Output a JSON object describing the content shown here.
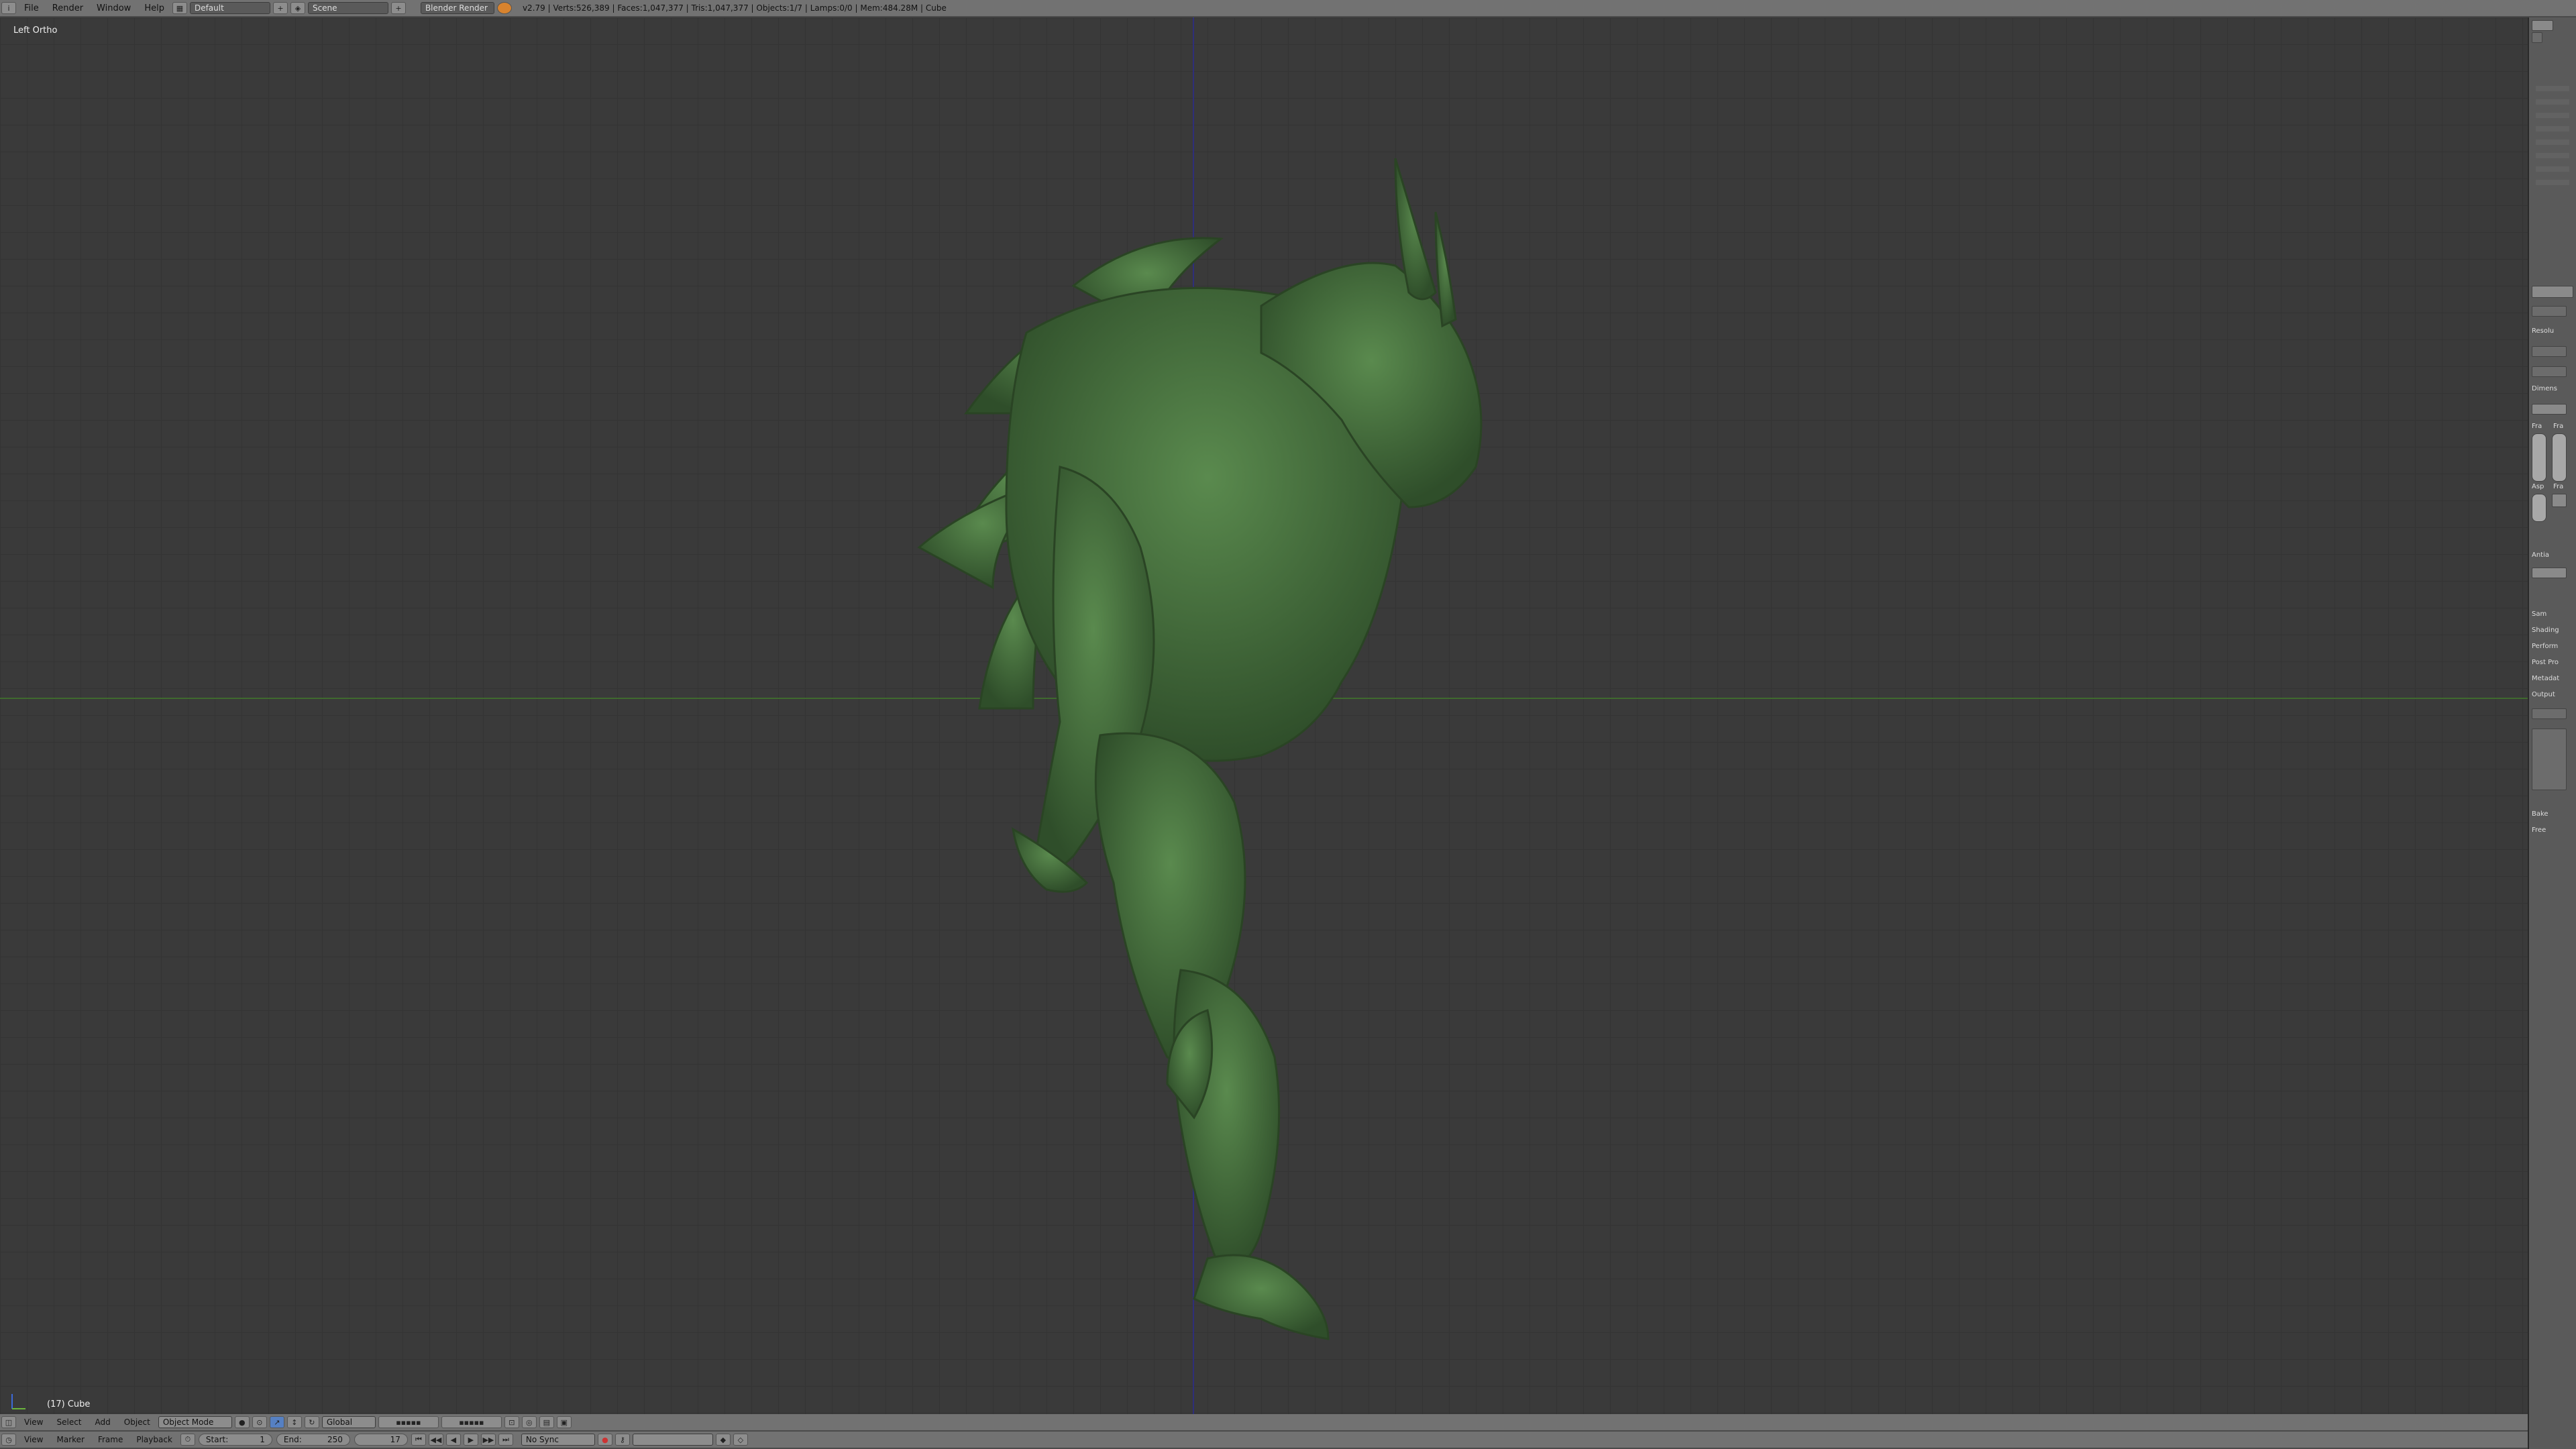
{
  "topbar": {
    "menus": [
      "File",
      "Render",
      "Window",
      "Help"
    ],
    "layout": "Default",
    "scene": "Scene",
    "engine": "Blender Render",
    "stats": "v2.79 | Verts:526,389 | Faces:1,047,377 | Tris:1,047,377 | Objects:1/7 | Lamps:0/0 | Mem:484.28M | Cube"
  },
  "viewport": {
    "view_label": "Left Ortho",
    "object_label": "(17) Cube",
    "model_color": "#4e7a44"
  },
  "header3d": {
    "menus": [
      "View",
      "Select",
      "Add",
      "Object"
    ],
    "mode": "Object Mode",
    "orientation": "Global"
  },
  "timeline": {
    "menus": [
      "View",
      "Marker",
      "Frame",
      "Playback"
    ],
    "start_label": "Start:",
    "start_value": "1",
    "end_label": "End:",
    "end_value": "250",
    "current_frame": "17",
    "sync": "No Sync"
  },
  "properties": {
    "items": [
      "Resolu",
      "Dimens",
      "Fra",
      "Fra",
      "Asp",
      "Fra",
      "Antia",
      "Sam",
      "Shading",
      "Perform",
      "Post Pro",
      "Metadat",
      "Output",
      "Bake",
      "Free"
    ]
  }
}
